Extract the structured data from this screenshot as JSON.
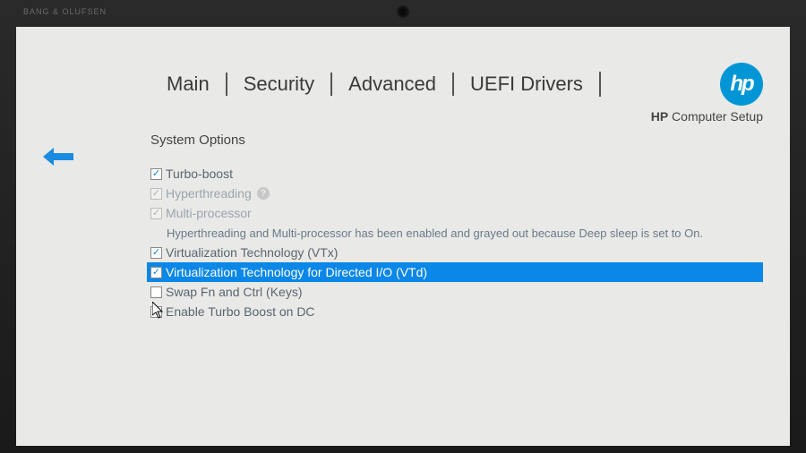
{
  "brand": "BANG & OLUFSEN",
  "tabs": [
    "Main",
    "Security",
    "Advanced",
    "UEFI Drivers"
  ],
  "active_tab_index": 2,
  "product_line_bold": "HP",
  "product_line_rest": " Computer Setup",
  "section_title": "System Options",
  "note_text": "Hyperthreading and Multi-processor has been enabled and grayed out because Deep sleep is set to On.",
  "options": [
    {
      "label": "Turbo-boost",
      "checked": true,
      "grayed": false
    },
    {
      "label": "Hyperthreading",
      "checked": true,
      "grayed": true,
      "help": true
    },
    {
      "label": "Multi-processor",
      "checked": true,
      "grayed": true
    },
    {
      "label": "Virtualization Technology (VTx)",
      "checked": true,
      "grayed": false
    },
    {
      "label": "Virtualization Technology for Directed I/O (VTd)",
      "checked": true,
      "grayed": false,
      "selected": true
    },
    {
      "label": "Swap Fn and Ctrl (Keys)",
      "checked": false,
      "grayed": false
    },
    {
      "label": "Enable Turbo Boost on DC",
      "checked": false,
      "grayed": false
    }
  ]
}
